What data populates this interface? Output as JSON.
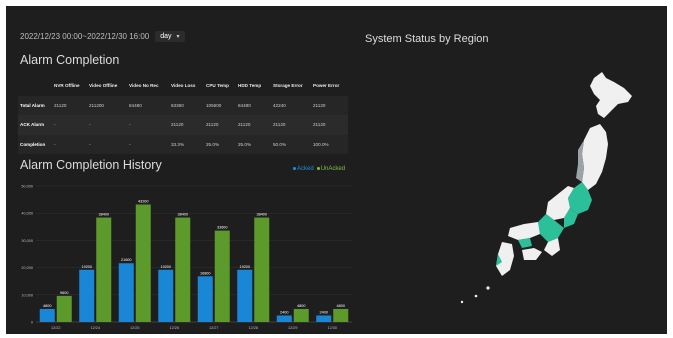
{
  "filter": {
    "date_range": "2022/12/23 00:00~2022/12/30 16:00",
    "unit": "day"
  },
  "completion": {
    "title": "Alarm Completion",
    "columns": [
      "",
      "NVR Offline",
      "Video Offline",
      "Video No Rec",
      "Video Loss",
      "CPU Temp",
      "HDD Temp",
      "Storage Error",
      "Power Error"
    ],
    "rows": [
      {
        "label": "Total Alarm",
        "cells": [
          "21120",
          "211200",
          "84480",
          "63360",
          "105600",
          "84480",
          "42240",
          "21120"
        ]
      },
      {
        "label": "ACK Alarm",
        "cells": [
          "-",
          "-",
          "-",
          "21120",
          "21120",
          "21120",
          "21120",
          "21120"
        ]
      },
      {
        "label": "Completion",
        "cells": [
          "-",
          "-",
          "-",
          "33.3%",
          "25.0%",
          "25.0%",
          "50.0%",
          "100.0%"
        ]
      }
    ]
  },
  "history": {
    "title": "Alarm Completion History",
    "legend": {
      "acked": "Acked",
      "unacked": "UnAcked"
    }
  },
  "colors": {
    "acked": "#1a86d6",
    "unacked": "#5d9a2c",
    "map_land": "#f0f0f0",
    "map_teal": "#2bbf9a",
    "map_grey": "#9aa4a8"
  },
  "chart_data": {
    "type": "bar",
    "categories": [
      "12/22",
      "12/24",
      "12/25",
      "12/26",
      "12/27",
      "12/28",
      "12/29",
      "12/30"
    ],
    "series": [
      {
        "name": "Acked",
        "values": [
          4800,
          19200,
          21600,
          19200,
          16800,
          19200,
          2400,
          2400
        ]
      },
      {
        "name": "UnAcked",
        "values": [
          9600,
          38400,
          43200,
          38400,
          33600,
          38400,
          4800,
          4800
        ]
      }
    ],
    "yticks": [
      "0",
      "10,000",
      "20,000",
      "30,000",
      "40,000",
      "50,000"
    ],
    "ylim": [
      0,
      50000
    ],
    "data_labels": true,
    "legend_position": "top-right"
  },
  "map": {
    "title": "System Status by Region"
  }
}
